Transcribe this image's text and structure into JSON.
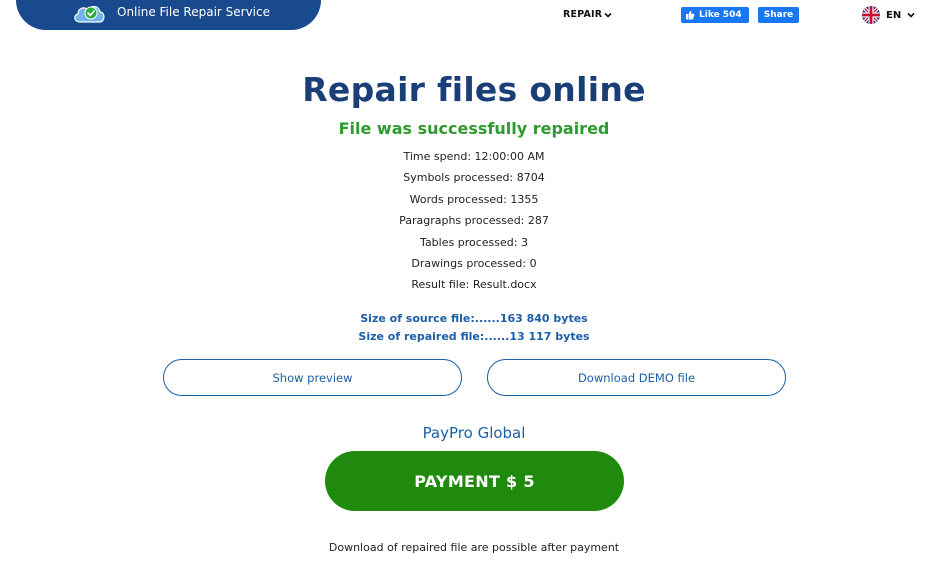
{
  "header": {
    "brand_title": "Online File Repair Service",
    "nav_repair": "REPAIR",
    "fb_like": "Like 504",
    "fb_share": "Share",
    "language": "EN"
  },
  "main": {
    "title": "Repair files online",
    "status": "File was successfully repaired",
    "stats": [
      "Time spend: 12:00:00 AM",
      "Symbols processed: 8704",
      "Words processed: 1355",
      "Paragraphs processed: 287",
      "Tables processed: 3",
      "Drawings processed: 0",
      "Result file: Result.docx"
    ],
    "sizes": [
      "Size of source file:......163 840 bytes",
      "Size of repaired file:......13 117 bytes"
    ],
    "show_preview": "Show preview",
    "download_demo": "Download DEMO file",
    "payment_provider": "PayPro Global",
    "payment_button": "PAYMENT $ 5",
    "note": "Download of repaired file are possible after payment"
  },
  "colors": {
    "brand_bar": "#1a4a8e",
    "title": "#1a3f78",
    "success": "#2f9a2f",
    "link_blue": "#1b5fa8",
    "pay_green": "#1f8a0e",
    "facebook": "#1877f2"
  },
  "icons": [
    "cloud-check-icon",
    "chevron-down-icon",
    "facebook-thumb-icon",
    "uk-flag-icon"
  ]
}
